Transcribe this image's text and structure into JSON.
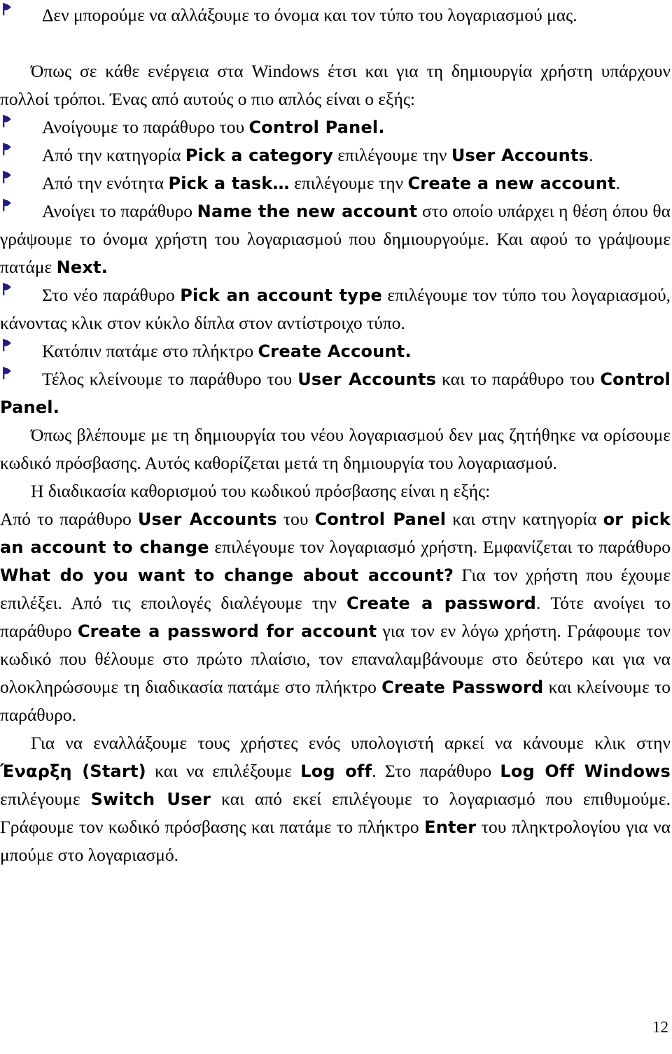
{
  "document": {
    "language": "el",
    "page_number": "12",
    "bullet_icon": "navy-flag-bullet",
    "bullet_color": "#1F1F7A",
    "text_color": "#000000",
    "background_color": "#FFFFFF"
  },
  "blocks": [
    {
      "id": "b1",
      "type": "bullet",
      "parts": [
        {
          "style": "greek",
          "text": "Δεν μπορούμε να αλλάξουμε το όνομα και τον τύπο του λογαριασμού μας."
        }
      ]
    },
    {
      "id": "p1",
      "type": "paragraph-indent",
      "parts": [
        {
          "style": "greek",
          "text": "Όπως σε κάθε ενέργεια στα Windows έτσι και για τη δημιουργία χρήστη υπάρχουν πολλοί τρόποι. Ένας από αυτούς ο πιο απλός είναι ο εξής:"
        }
      ]
    },
    {
      "id": "b2",
      "type": "bullet",
      "parts": [
        {
          "style": "greek",
          "text": "Ανοίγουμε το παράθυρο του "
        },
        {
          "style": "ui",
          "text": "Control Panel."
        }
      ]
    },
    {
      "id": "b3",
      "type": "bullet",
      "parts": [
        {
          "style": "greek",
          "text": "Από την κατηγορία "
        },
        {
          "style": "ui",
          "text": "Pick a category"
        },
        {
          "style": "greek",
          "text": " επιλέγουμε την "
        },
        {
          "style": "ui",
          "text": "User Accounts"
        },
        {
          "style": "greek",
          "text": "."
        }
      ]
    },
    {
      "id": "b4",
      "type": "bullet",
      "parts": [
        {
          "style": "greek",
          "text": "Από την ενότητα "
        },
        {
          "style": "ui",
          "text": "Pick a task…"
        },
        {
          "style": "greek",
          "text": " επιλέγουμε την "
        },
        {
          "style": "ui",
          "text": "Create a new account"
        },
        {
          "style": "greek",
          "text": "."
        }
      ]
    },
    {
      "id": "b5",
      "type": "bullet",
      "parts": [
        {
          "style": "greek",
          "text": "Ανοίγει το παράθυρο "
        },
        {
          "style": "ui",
          "text": "Name the new account"
        },
        {
          "style": "greek",
          "text": " στο οποίο υπάρχει η θέση όπου θα γράψουμε το όνομα χρήστη του λογαριασμού που δημιουργούμε. Και αφού το γράψουμε πατάμε "
        },
        {
          "style": "ui",
          "text": "Next."
        }
      ]
    },
    {
      "id": "b6",
      "type": "bullet",
      "parts": [
        {
          "style": "greek",
          "text": "Στο νέο παράθυρο "
        },
        {
          "style": "ui",
          "text": "Pick an account type"
        },
        {
          "style": "greek",
          "text": " επιλέγουμε τον τύπο του λογαριασμού, κάνοντας κλικ στον κύκλο δίπλα στον αντίστροιχο τύπο."
        }
      ]
    },
    {
      "id": "b7",
      "type": "bullet",
      "parts": [
        {
          "style": "greek",
          "text": "Κατόπιν πατάμε στο πλήκτρο "
        },
        {
          "style": "ui",
          "text": "Create Account."
        }
      ]
    },
    {
      "id": "b8",
      "type": "bullet",
      "parts": [
        {
          "style": "greek",
          "text": "Τέλος κλείνουμε το παράθυρο του "
        },
        {
          "style": "ui",
          "text": "User Accounts"
        },
        {
          "style": "greek",
          "text": " και το παράθυρο του "
        },
        {
          "style": "ui",
          "text": "Control Panel."
        }
      ]
    },
    {
      "id": "p2",
      "type": "paragraph-indent",
      "parts": [
        {
          "style": "greek",
          "text": "Όπως βλέπουμε με τη δημιουργία του νέου λογαριασμού δεν μας ζητήθηκε να ορίσουμε κωδικό πρόσβασης. Αυτός καθορίζεται μετά τη δημιουργία του λογαριασμού."
        }
      ]
    },
    {
      "id": "p3",
      "type": "paragraph-indent",
      "parts": [
        {
          "style": "greek",
          "text": "Η διαδικασία καθορισμού του κωδικού πρόσβασης είναι η εξής:"
        }
      ]
    },
    {
      "id": "p4",
      "type": "paragraph",
      "parts": [
        {
          "style": "greek",
          "text": "Από το παράθυρο "
        },
        {
          "style": "ui",
          "text": "User Accounts"
        },
        {
          "style": "greek",
          "text": " του "
        },
        {
          "style": "ui",
          "text": "Control Panel"
        },
        {
          "style": "greek",
          "text": " και στην κατηγορία  "
        },
        {
          "style": "ui",
          "text": "or pick an account to change"
        },
        {
          "style": "greek",
          "text": " επιλέγουμε τον λογαριασμό χρήστη. Εμφανίζεται το παράθυρο "
        },
        {
          "style": "ui",
          "text": "What do you want to change about account?"
        },
        {
          "style": "greek",
          "text": " Για τον χρήστη που έχουμε επιλέξει. Από τις εποιλογές διαλέγουμε την "
        },
        {
          "style": "ui",
          "text": "Create a password"
        },
        {
          "style": "greek",
          "text": ". Τότε ανοίγει το παράθυρο "
        },
        {
          "style": "ui",
          "text": "Create a password for account"
        },
        {
          "style": "greek",
          "text": " για τον εν λόγω χρήστη. Γράφουμε τον κωδικό που θέλουμε στο πρώτο πλαίσιο, τον επαναλαμβάνουμε στο δεύτερο και για να ολοκληρώσουμε τη διαδικασία πατάμε στο πλήκτρο "
        },
        {
          "style": "ui",
          "text": "Create Password"
        },
        {
          "style": "greek",
          "text": " και κλείνουμε το παράθυρο."
        }
      ]
    },
    {
      "id": "p5",
      "type": "paragraph-indent",
      "parts": [
        {
          "style": "greek",
          "text": "Για να εναλλάξουμε τους χρήστες ενός υπολογιστή αρκεί να κάνουμε κλικ στην "
        },
        {
          "style": "ui",
          "text": "Έναρξη (Start)"
        },
        {
          "style": "greek",
          "text": " και να επιλέξουμε "
        },
        {
          "style": "ui",
          "text": "Log off"
        },
        {
          "style": "greek",
          "text": ". Στο παράθυρο "
        },
        {
          "style": "ui",
          "text": "Log Off Windows"
        },
        {
          "style": "greek",
          "text": " επιλέγουμε "
        },
        {
          "style": "ui",
          "text": "Switch User"
        },
        {
          "style": "greek",
          "text": " και από εκεί επιλέγουμε το λογαριασμό που επιθυμούμε. Γράφουμε τον κωδικό πρόσβασης και πατάμε το πλήκτρο "
        },
        {
          "style": "ui",
          "text": "Enter"
        },
        {
          "style": "greek",
          "text": " του πληκτρολογίου για να μπούμε στο λογαριασμό."
        }
      ]
    }
  ]
}
